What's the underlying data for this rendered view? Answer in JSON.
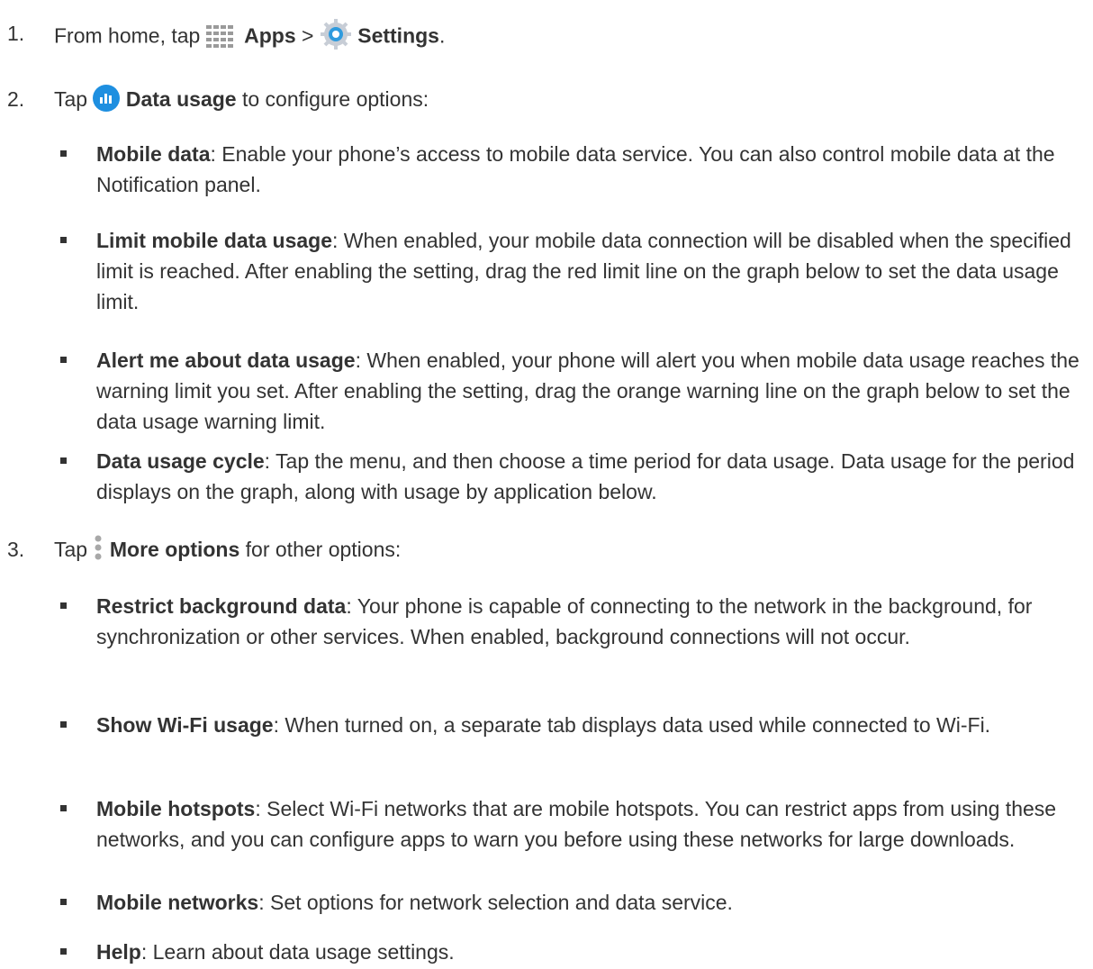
{
  "steps": [
    {
      "num": "1.",
      "pre": "From home, tap",
      "bold1": "Apps",
      "sep": ">",
      "bold2": "Settings",
      "post": "."
    },
    {
      "num": "2.",
      "pre": "Tap",
      "bold": "Data usage",
      "post": "to configure options:"
    },
    {
      "num": "3.",
      "pre": "Tap",
      "bold": "More options",
      "post": "for other options:"
    }
  ],
  "icons": [
    "apps-grid-icon",
    "settings-gear-icon",
    "data-usage-icon",
    "more-options-icon"
  ],
  "bullets": [
    {
      "label": "Mobile data",
      "text": ": Enable your phone’s access to mobile data service. You can also control mobile data at the Notification panel."
    },
    {
      "label": "Limit mobile data usage",
      "text": ": When enabled, your mobile data connection will be disabled when the specified limit is reached. After enabling the setting, drag the red limit line on the graph below to set the data usage limit."
    },
    {
      "label": "Alert me about data usage",
      "text": ": When enabled, your phone will alert you when mobile data usage reaches the warning limit you set. After enabling the setting, drag the orange warning line on the graph below to set the data usage warning limit."
    },
    {
      "label": "Data usage cycle",
      "text": ": Tap the menu, and then choose a time period for data usage. Data usage for the period displays on the graph, along with usage by application below."
    },
    {
      "label": "Restrict background data",
      "text": ": Your phone is capable of connecting to the network in the background, for synchronization or other services. When enabled, background connections will not occur."
    },
    {
      "label": "Show Wi-Fi usage",
      "text": ": When turned on, a separate tab displays data used while connected to Wi-Fi."
    },
    {
      "label": "Mobile hotspots",
      "text": ": Select Wi-Fi networks that are mobile hotspots. You can restrict apps from using these networks, and you can configure apps to warn you before using these networks for large downloads."
    },
    {
      "label": "Mobile networks",
      "text": ": Set options for network selection and data service."
    },
    {
      "label": "Help",
      "text": ": Learn about data usage settings."
    }
  ]
}
